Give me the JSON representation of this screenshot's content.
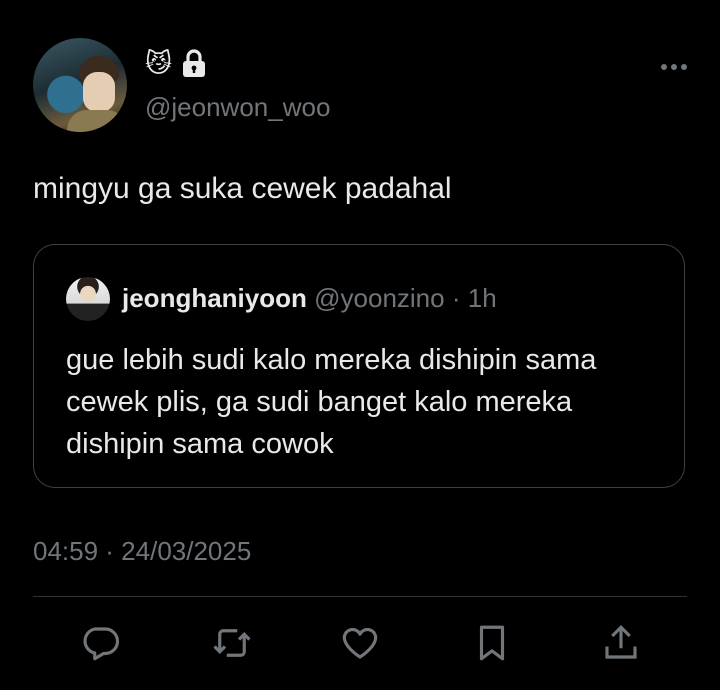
{
  "author": {
    "handle": "@jeonwon_woo",
    "badge_emoji": "😼",
    "lock_icon": "lock-icon"
  },
  "tweet": {
    "text": "mingyu ga suka cewek padahal"
  },
  "quoted": {
    "name": "jeonghaniyoon",
    "handle": "@yoonzino",
    "separator": "·",
    "time": "1h",
    "text": "gue lebih sudi kalo mereka dishipin sama cewek plis, ga sudi banget kalo mereka dishipin sama cowok"
  },
  "timestamp": "04:59 · 24/03/2025",
  "actions": [
    {
      "icon": "reply-icon"
    },
    {
      "icon": "retweet-icon"
    },
    {
      "icon": "like-icon"
    },
    {
      "icon": "bookmark-icon"
    },
    {
      "icon": "share-icon"
    }
  ],
  "colors": {
    "background": "#000000",
    "text": "#e7e9ea",
    "muted": "#71767b",
    "border": "#3e4144"
  }
}
